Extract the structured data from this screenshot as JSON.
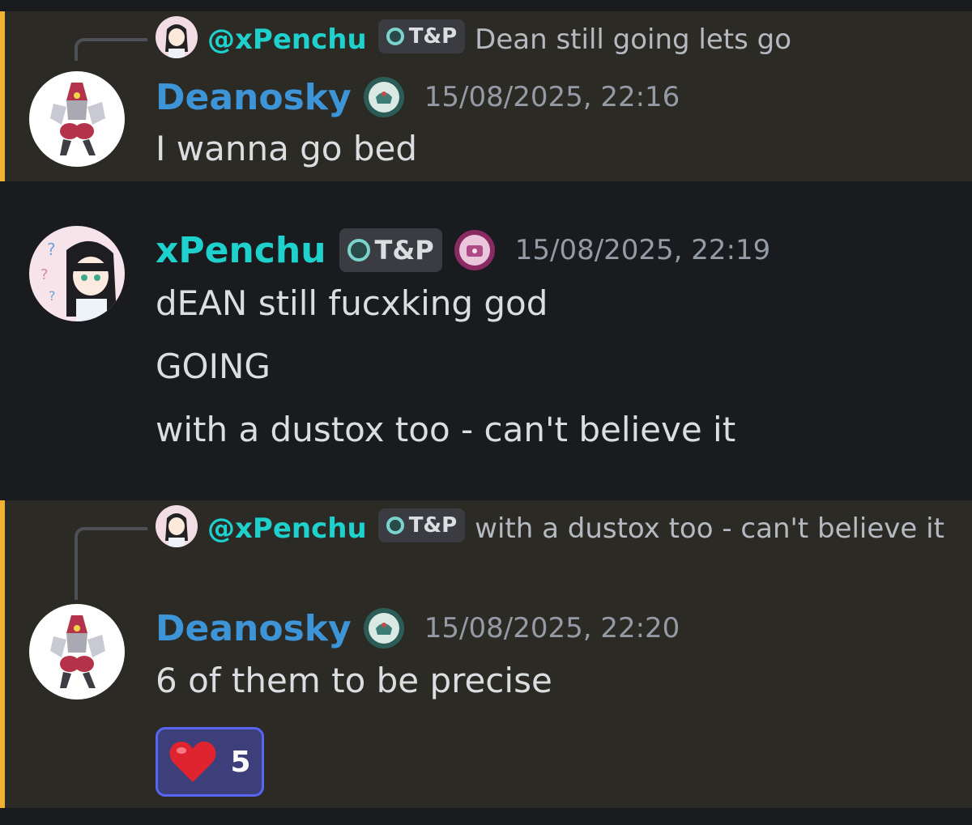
{
  "messages": [
    {
      "reply": {
        "name": "@xPenchu",
        "tag": "T&P",
        "text": "Dean still going lets go"
      },
      "author": "Deanosky",
      "timestamp": "15/08/2025, 22:16",
      "lines": [
        "I wanna go bed"
      ]
    },
    {
      "author": "xPenchu",
      "tag": "T&P",
      "timestamp": "15/08/2025, 22:19",
      "lines": [
        "dEAN still fucxking god",
        "GOING",
        "with a dustox too - can't believe it"
      ]
    },
    {
      "reply": {
        "name": "@xPenchu",
        "tag": "T&P",
        "text": "with a dustox too - can't believe it"
      },
      "author": "Deanosky",
      "timestamp": "15/08/2025, 22:20",
      "lines": [
        "6 of them to be precise"
      ],
      "reaction": {
        "emoji": "heart-emoji",
        "count": "5"
      }
    }
  ],
  "colors": {
    "background": "#1a1b1f",
    "highlight_background": "#2c2a25",
    "highlight_bar": "#f0b232",
    "deanosky_name": "#3d94d6",
    "xpenchu_name": "#1fd1cc",
    "reaction_border": "#5865f2"
  },
  "icons": {
    "badge_deanosky": "tea-pizza-badge-icon",
    "badge_xpenchu": "tea-spice-badge-icon",
    "tag_glyph": "ring-icon"
  }
}
